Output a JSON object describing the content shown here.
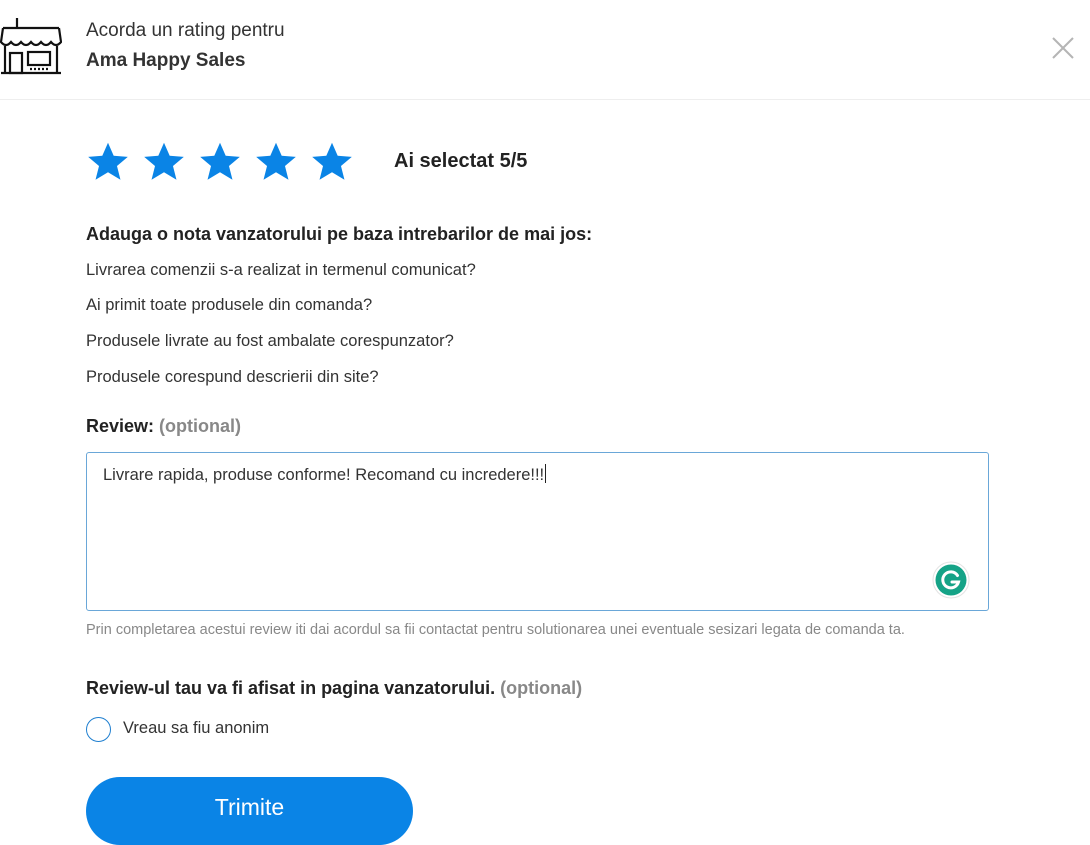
{
  "header": {
    "subtitle": "Acorda un rating pentru",
    "seller_name": "Ama Happy Sales"
  },
  "rating": {
    "value": 5,
    "max": 5,
    "selected_text": "Ai selectat 5/5",
    "star_color": "#0a84e6"
  },
  "questions": {
    "heading": "Adauga o nota vanzatorului pe baza intrebarilor de mai jos:",
    "items": [
      "Livrarea comenzii s-a realizat in termenul comunicat?",
      "Ai primit toate produsele din comanda?",
      "Produsele livrate au fost ambalate corespunzator?",
      "Produsele corespund descrierii din site?"
    ]
  },
  "review": {
    "label": "Review:",
    "optional": "(optional)",
    "value": "Livrare rapida, produse conforme! Recomand cu incredere!!!",
    "consent": "Prin completarea acestui review iti dai acordul sa fii contactat pentru solutionarea unei eventuale sesizari legata de comanda ta."
  },
  "display": {
    "label": "Review-ul tau va fi afisat in pagina vanzatorului.",
    "optional": "(optional)",
    "anonymous_label": "Vreau sa fiu anonim",
    "anonymous_checked": false
  },
  "submit": {
    "label": "Trimite",
    "color": "#0a84e6"
  },
  "icons": {
    "store": "store-icon",
    "close": "close-icon",
    "star": "star-icon",
    "grammarly": "grammarly-icon"
  }
}
